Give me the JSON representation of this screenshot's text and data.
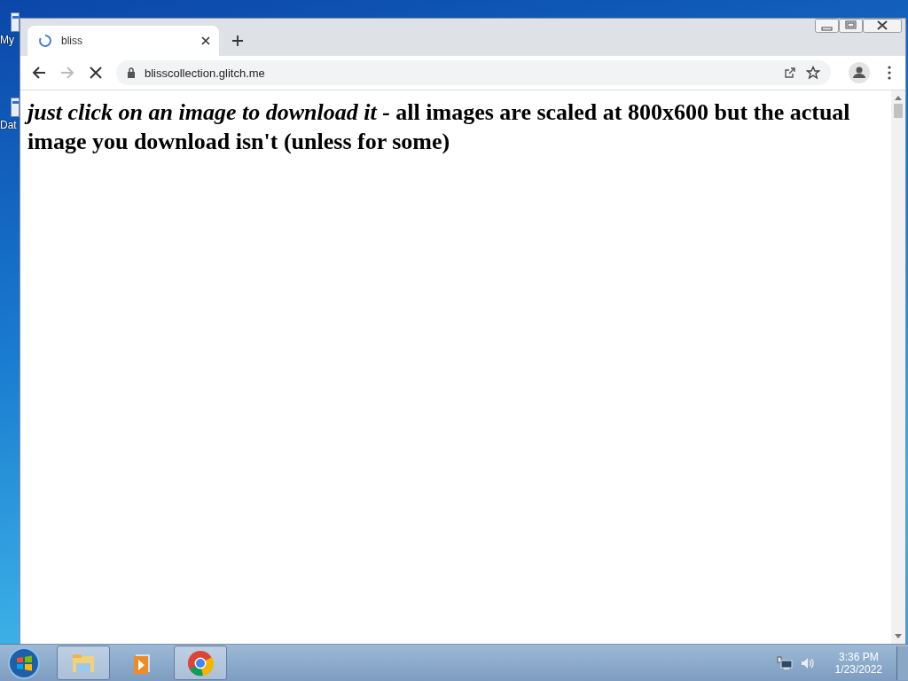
{
  "desktop_icons": [
    {
      "label": "My"
    },
    {
      "label": "Dat"
    }
  ],
  "browser": {
    "tabs": [
      {
        "title": "bliss",
        "loading": true,
        "selected": true
      }
    ],
    "address": "blisscollection.glitch.me",
    "page": {
      "heading": "*just click on an image to download it -* all images are scaled at 800x600 but the actual image you download isn't (unless for some)"
    }
  },
  "taskbar": {
    "buttons": [
      {
        "kind": "explorer",
        "running": true
      },
      {
        "kind": "media",
        "running": false
      },
      {
        "kind": "chrome",
        "running": true
      }
    ],
    "clock": {
      "time": "3:36 PM",
      "date": "1/23/2022"
    }
  }
}
